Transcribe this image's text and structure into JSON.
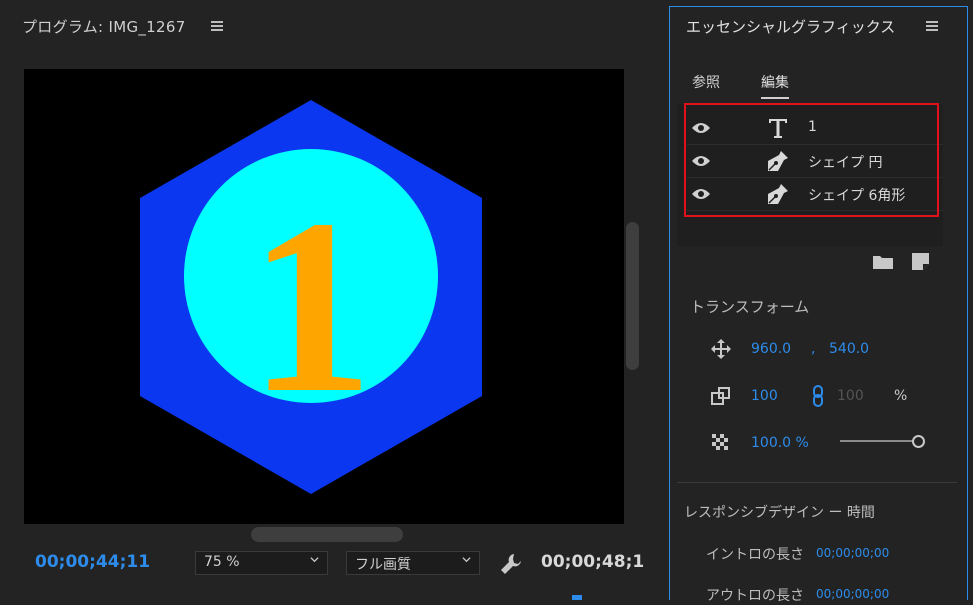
{
  "program_monitor": {
    "title": "プログラム: IMG_1267",
    "timecode_current": "00;00;44;11",
    "zoom": "75 %",
    "quality": "フル画質",
    "timecode_duration": "00;00;48;1",
    "frame": {
      "text": "1",
      "colors": {
        "background": "#000000",
        "hexagon": "#0b37f0",
        "circle": "#00ffff",
        "numeral": "#ffa500"
      }
    }
  },
  "essential_graphics": {
    "title": "エッセンシャルグラフィックス",
    "tabs": [
      {
        "label": "参照"
      },
      {
        "label": "編集"
      }
    ],
    "active_tab": "編集",
    "layers": [
      {
        "icon": "text-tool-icon",
        "name": "1",
        "visible": true
      },
      {
        "icon": "pen-tool-icon",
        "name": "シェイプ 円",
        "visible": true
      },
      {
        "icon": "pen-tool-icon",
        "name": "シェイプ 6角形",
        "visible": true
      }
    ],
    "highlight_color": "#e3101b",
    "transform": {
      "title": "トランスフォーム",
      "position_x": "960.0",
      "position_sep": ",",
      "position_y": "540.0",
      "scale": "100",
      "scale_height": "100",
      "scale_unit": "%",
      "opacity": "100.0 %",
      "opacity_level": 1.0
    },
    "responsive_design": {
      "title": "レスポンシブデザイン ー 時間",
      "intro_label": "イントロの長さ",
      "intro_value": "00;00;00;00",
      "outro_label": "アウトロの長さ",
      "outro_value": "00;00;00;00"
    }
  },
  "colors": {
    "accent": "#2d8ceb",
    "panel_bg": "#232323"
  }
}
